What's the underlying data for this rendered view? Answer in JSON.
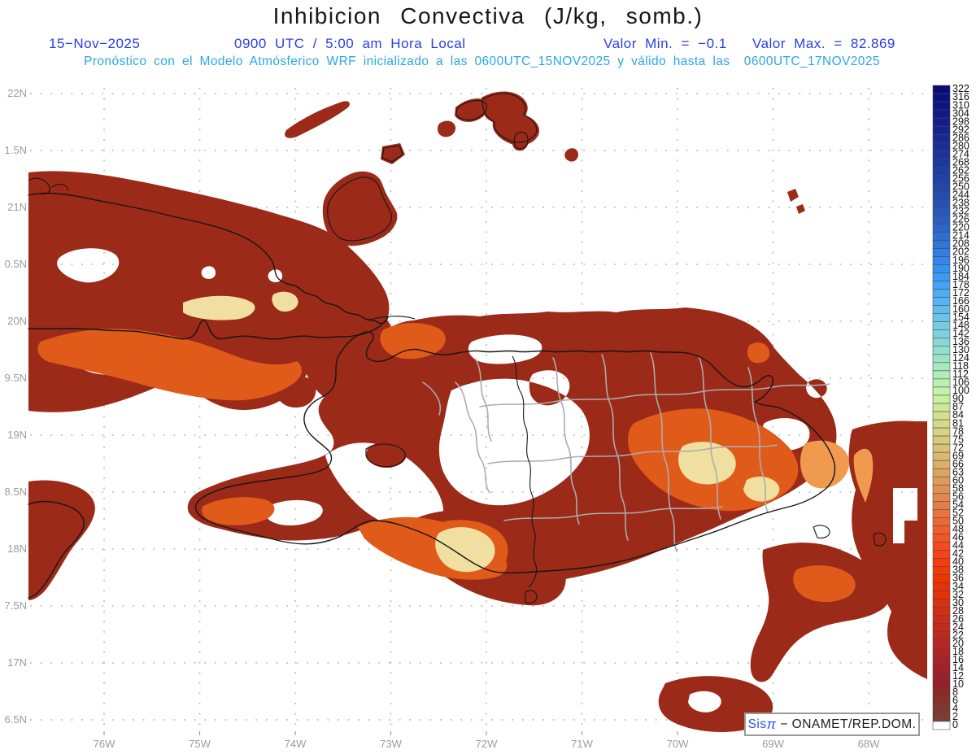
{
  "header": {
    "title": "Inhibicion Convectiva (J/kg, somb.)",
    "date": "15−Nov−2025",
    "time": "0900 UTC / 5:00 am Hora Local",
    "min_label": "Valor Min. = −0.1",
    "max_label": "Valor Max. = 82.869",
    "subtitle": "Pronóstico con el Modelo Atmósferico WRF inicializado a las 0600UTC_15NOV2025 y válido hasta las  0600UTC_17NOV2025"
  },
  "branding": {
    "sis": "Sis",
    "pi": "π",
    "rest": " − ONAMET/REP.DOM."
  },
  "colors": {
    "header_blue": "#2a41e0",
    "header_cyan": "#2ba6ea",
    "axis_gray": "#9c9c9c",
    "grid_gray": "#c4c4c4",
    "coast_black": "#161616",
    "province_gray": "#acacac",
    "field_dark_red": "#9b2a19",
    "field_orange": "#e05a1a",
    "field_light_orange": "#f09a50",
    "field_cream": "#f0dfa0"
  },
  "map": {
    "x_tick_labels": [
      "76W",
      "75W",
      "74W",
      "73W",
      "72W",
      "71W",
      "70W",
      "69W",
      "68W"
    ],
    "y_tick_labels": [
      "22N",
      "1.5N",
      "21N",
      "0.5N",
      "20N",
      "9.5N",
      "19N",
      "8.5N",
      "18N",
      "7.5N",
      "17N",
      "6.5N"
    ]
  },
  "chart_data": {
    "type": "heatmap",
    "title": "Inhibicion Convectiva",
    "units": "J/kg",
    "valor_min": -0.1,
    "valor_max": 82.869,
    "model_run": "0600UTC_15NOV2025",
    "valid_until": "0600UTC_17NOV2025",
    "display_time": "0900 UTC / 5:00 am Hora Local",
    "x_axis": {
      "ticks": [
        "76W",
        "75W",
        "74W",
        "73W",
        "72W",
        "71W",
        "70W",
        "69W",
        "68W"
      ]
    },
    "y_axis": {
      "ticks_displayed": [
        "22N",
        "1.5N",
        "21N",
        "0.5N",
        "20N",
        "9.5N",
        "19N",
        "8.5N",
        "18N",
        "7.5N",
        "17N",
        "6.5N"
      ]
    },
    "legend_position": "right",
    "grid": "dotted",
    "colorbar": {
      "values": [
        322,
        316,
        310,
        304,
        298,
        292,
        286,
        280,
        274,
        268,
        262,
        256,
        250,
        244,
        238,
        232,
        226,
        220,
        214,
        208,
        202,
        196,
        190,
        184,
        178,
        172,
        166,
        160,
        154,
        148,
        142,
        136,
        130,
        124,
        118,
        112,
        106,
        100,
        90,
        87,
        84,
        81,
        78,
        75,
        72,
        69,
        66,
        63,
        60,
        58,
        56,
        54,
        52,
        50,
        48,
        46,
        44,
        42,
        40,
        38,
        36,
        34,
        32,
        30,
        28,
        26,
        24,
        22,
        20,
        18,
        16,
        14,
        12,
        10,
        8,
        6,
        4,
        2,
        0
      ],
      "colors": [
        "#0a0a7a",
        "#0c0f7e",
        "#0e1482",
        "#101986",
        "#121e8a",
        "#14238e",
        "#162892",
        "#182d96",
        "#1a329a",
        "#1c389e",
        "#1e3da2",
        "#2042a6",
        "#2247ab",
        "#244daf",
        "#2652b4",
        "#2858b9",
        "#2a5ec0",
        "#2c66c9",
        "#2e6ed2",
        "#2f76db",
        "#317ee4",
        "#3387ec",
        "#3590f3",
        "#3c9af6",
        "#44a3f5",
        "#4dacf3",
        "#56b4f0",
        "#60bcec",
        "#6ac4e7",
        "#74cbe2",
        "#7ed2dc",
        "#88d8d6",
        "#92decf",
        "#9ce4c8",
        "#a6e9c1",
        "#b0edba",
        "#baf1b2",
        "#c3f3aa",
        "#c9efa0",
        "#cde898",
        "#d1e190",
        "#d4da89",
        "#d6d282",
        "#d8ca7c",
        "#d9c176",
        "#dab870",
        "#dbaf6a",
        "#dca564",
        "#dd9b5e",
        "#df9156",
        "#e2874e",
        "#e57d46",
        "#e8733e",
        "#eb6936",
        "#ee5f2e",
        "#f15526",
        "#f44b1e",
        "#f74116",
        "#f83b0e",
        "#f43806",
        "#ee3604",
        "#e73407",
        "#e0320b",
        "#d9300f",
        "#d22e13",
        "#cb2c17",
        "#c42a1b",
        "#bd281f",
        "#b62623",
        "#af2425",
        "#a82327",
        "#a12128",
        "#9a2029",
        "#931f2a",
        "#8c2828",
        "#853029",
        "#7e382f",
        "#774035",
        "#ffffff"
      ]
    }
  }
}
